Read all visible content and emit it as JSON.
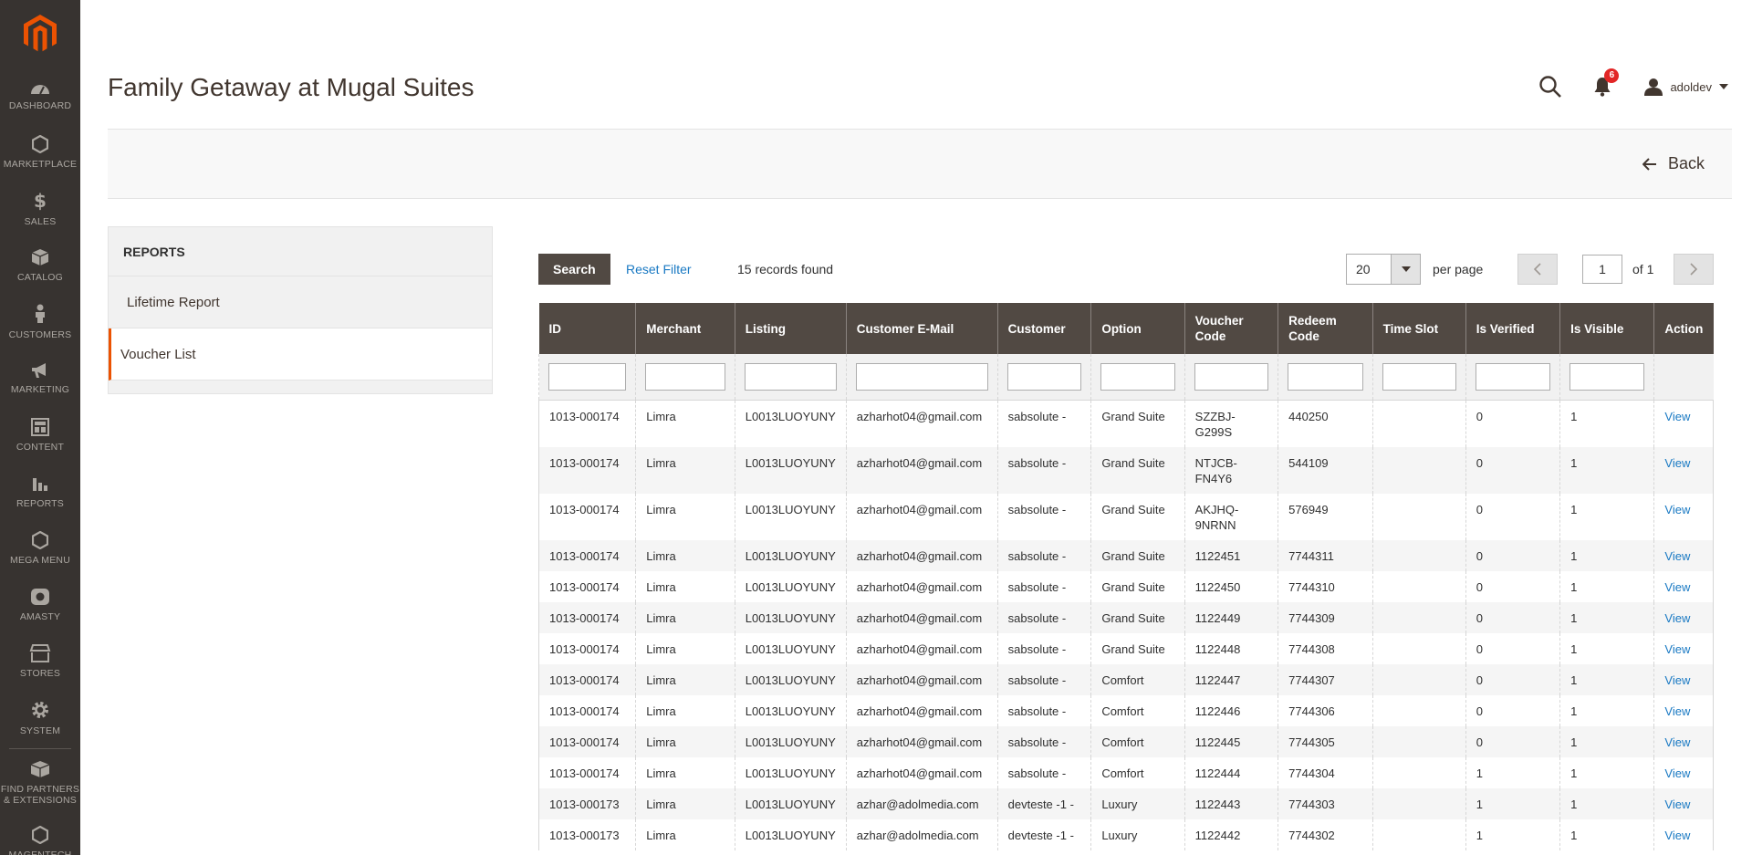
{
  "nav": {
    "items": [
      {
        "label": "DASHBOARD",
        "icon": "dashboard-icon"
      },
      {
        "label": "MARKETPLACE",
        "icon": "hexagon-icon"
      },
      {
        "label": "SALES",
        "icon": "dollar-icon"
      },
      {
        "label": "CATALOG",
        "icon": "box-icon"
      },
      {
        "label": "CUSTOMERS",
        "icon": "person-icon"
      },
      {
        "label": "MARKETING",
        "icon": "megaphone-icon"
      },
      {
        "label": "CONTENT",
        "icon": "layout-icon"
      },
      {
        "label": "REPORTS",
        "icon": "bar-chart-icon"
      },
      {
        "label": "MEGA MENU",
        "icon": "hexagon-icon"
      },
      {
        "label": "AMASTY",
        "icon": "amasty-icon"
      },
      {
        "label": "STORES",
        "icon": "store-icon"
      },
      {
        "label": "SYSTEM",
        "icon": "gear-icon"
      },
      {
        "label": "FIND PARTNERS & EXTENSIONS",
        "icon": "cube-icon"
      },
      {
        "label": "MAGENTECH",
        "icon": "hexagon-icon"
      }
    ]
  },
  "header": {
    "title": "Family Getaway at Mugal Suites",
    "notification_count": "6",
    "username": "adoldev",
    "back_label": "Back"
  },
  "sidebar": {
    "title": "REPORTS",
    "links": [
      "Lifetime Report",
      "Voucher List"
    ],
    "active": "Voucher List"
  },
  "toolbar": {
    "search_label": "Search",
    "reset_label": "Reset Filter",
    "records_text": "15 records found",
    "per_page_value": "20",
    "per_page_label": "per page",
    "page_value": "1",
    "page_of": "of 1"
  },
  "table": {
    "columns": [
      "ID",
      "Merchant",
      "Listing",
      "Customer E-Mail",
      "Customer",
      "Option",
      "Voucher Code",
      "Redeem Code",
      "Time Slot",
      "Is Verified",
      "Is Visible",
      "Action"
    ],
    "rows": [
      [
        "1013-000174",
        "Limra",
        "L0013LUOYUNY",
        "azharhot04@gmail.com",
        "sabsolute -",
        "Grand Suite",
        "SZZBJ-G299S",
        "440250",
        "",
        "0",
        "1",
        "View"
      ],
      [
        "1013-000174",
        "Limra",
        "L0013LUOYUNY",
        "azharhot04@gmail.com",
        "sabsolute -",
        "Grand Suite",
        "NTJCB-FN4Y6",
        "544109",
        "",
        "0",
        "1",
        "View"
      ],
      [
        "1013-000174",
        "Limra",
        "L0013LUOYUNY",
        "azharhot04@gmail.com",
        "sabsolute -",
        "Grand Suite",
        "AKJHQ-9NRNN",
        "576949",
        "",
        "0",
        "1",
        "View"
      ],
      [
        "1013-000174",
        "Limra",
        "L0013LUOYUNY",
        "azharhot04@gmail.com",
        "sabsolute -",
        "Grand Suite",
        "1122451",
        "7744311",
        "",
        "0",
        "1",
        "View"
      ],
      [
        "1013-000174",
        "Limra",
        "L0013LUOYUNY",
        "azharhot04@gmail.com",
        "sabsolute -",
        "Grand Suite",
        "1122450",
        "7744310",
        "",
        "0",
        "1",
        "View"
      ],
      [
        "1013-000174",
        "Limra",
        "L0013LUOYUNY",
        "azharhot04@gmail.com",
        "sabsolute -",
        "Grand Suite",
        "1122449",
        "7744309",
        "",
        "0",
        "1",
        "View"
      ],
      [
        "1013-000174",
        "Limra",
        "L0013LUOYUNY",
        "azharhot04@gmail.com",
        "sabsolute -",
        "Grand Suite",
        "1122448",
        "7744308",
        "",
        "0",
        "1",
        "View"
      ],
      [
        "1013-000174",
        "Limra",
        "L0013LUOYUNY",
        "azharhot04@gmail.com",
        "sabsolute -",
        "Comfort",
        "1122447",
        "7744307",
        "",
        "0",
        "1",
        "View"
      ],
      [
        "1013-000174",
        "Limra",
        "L0013LUOYUNY",
        "azharhot04@gmail.com",
        "sabsolute -",
        "Comfort",
        "1122446",
        "7744306",
        "",
        "0",
        "1",
        "View"
      ],
      [
        "1013-000174",
        "Limra",
        "L0013LUOYUNY",
        "azharhot04@gmail.com",
        "sabsolute -",
        "Comfort",
        "1122445",
        "7744305",
        "",
        "0",
        "1",
        "View"
      ],
      [
        "1013-000174",
        "Limra",
        "L0013LUOYUNY",
        "azharhot04@gmail.com",
        "sabsolute -",
        "Comfort",
        "1122444",
        "7744304",
        "",
        "1",
        "1",
        "View"
      ],
      [
        "1013-000173",
        "Limra",
        "L0013LUOYUNY",
        "azhar@adolmedia.com",
        "devteste -1 -",
        "Luxury",
        "1122443",
        "7744303",
        "",
        "1",
        "1",
        "View"
      ],
      [
        "1013-000173",
        "Limra",
        "L0013LUOYUNY",
        "azhar@adolmedia.com",
        "devteste -1 -",
        "Luxury",
        "1122442",
        "7744302",
        "",
        "1",
        "1",
        "View"
      ]
    ]
  },
  "colors": {
    "nav_bg": "#373330",
    "header_bg": "#514943",
    "accent": "#eb5202",
    "link": "#1979c3",
    "badge": "#e22626"
  }
}
